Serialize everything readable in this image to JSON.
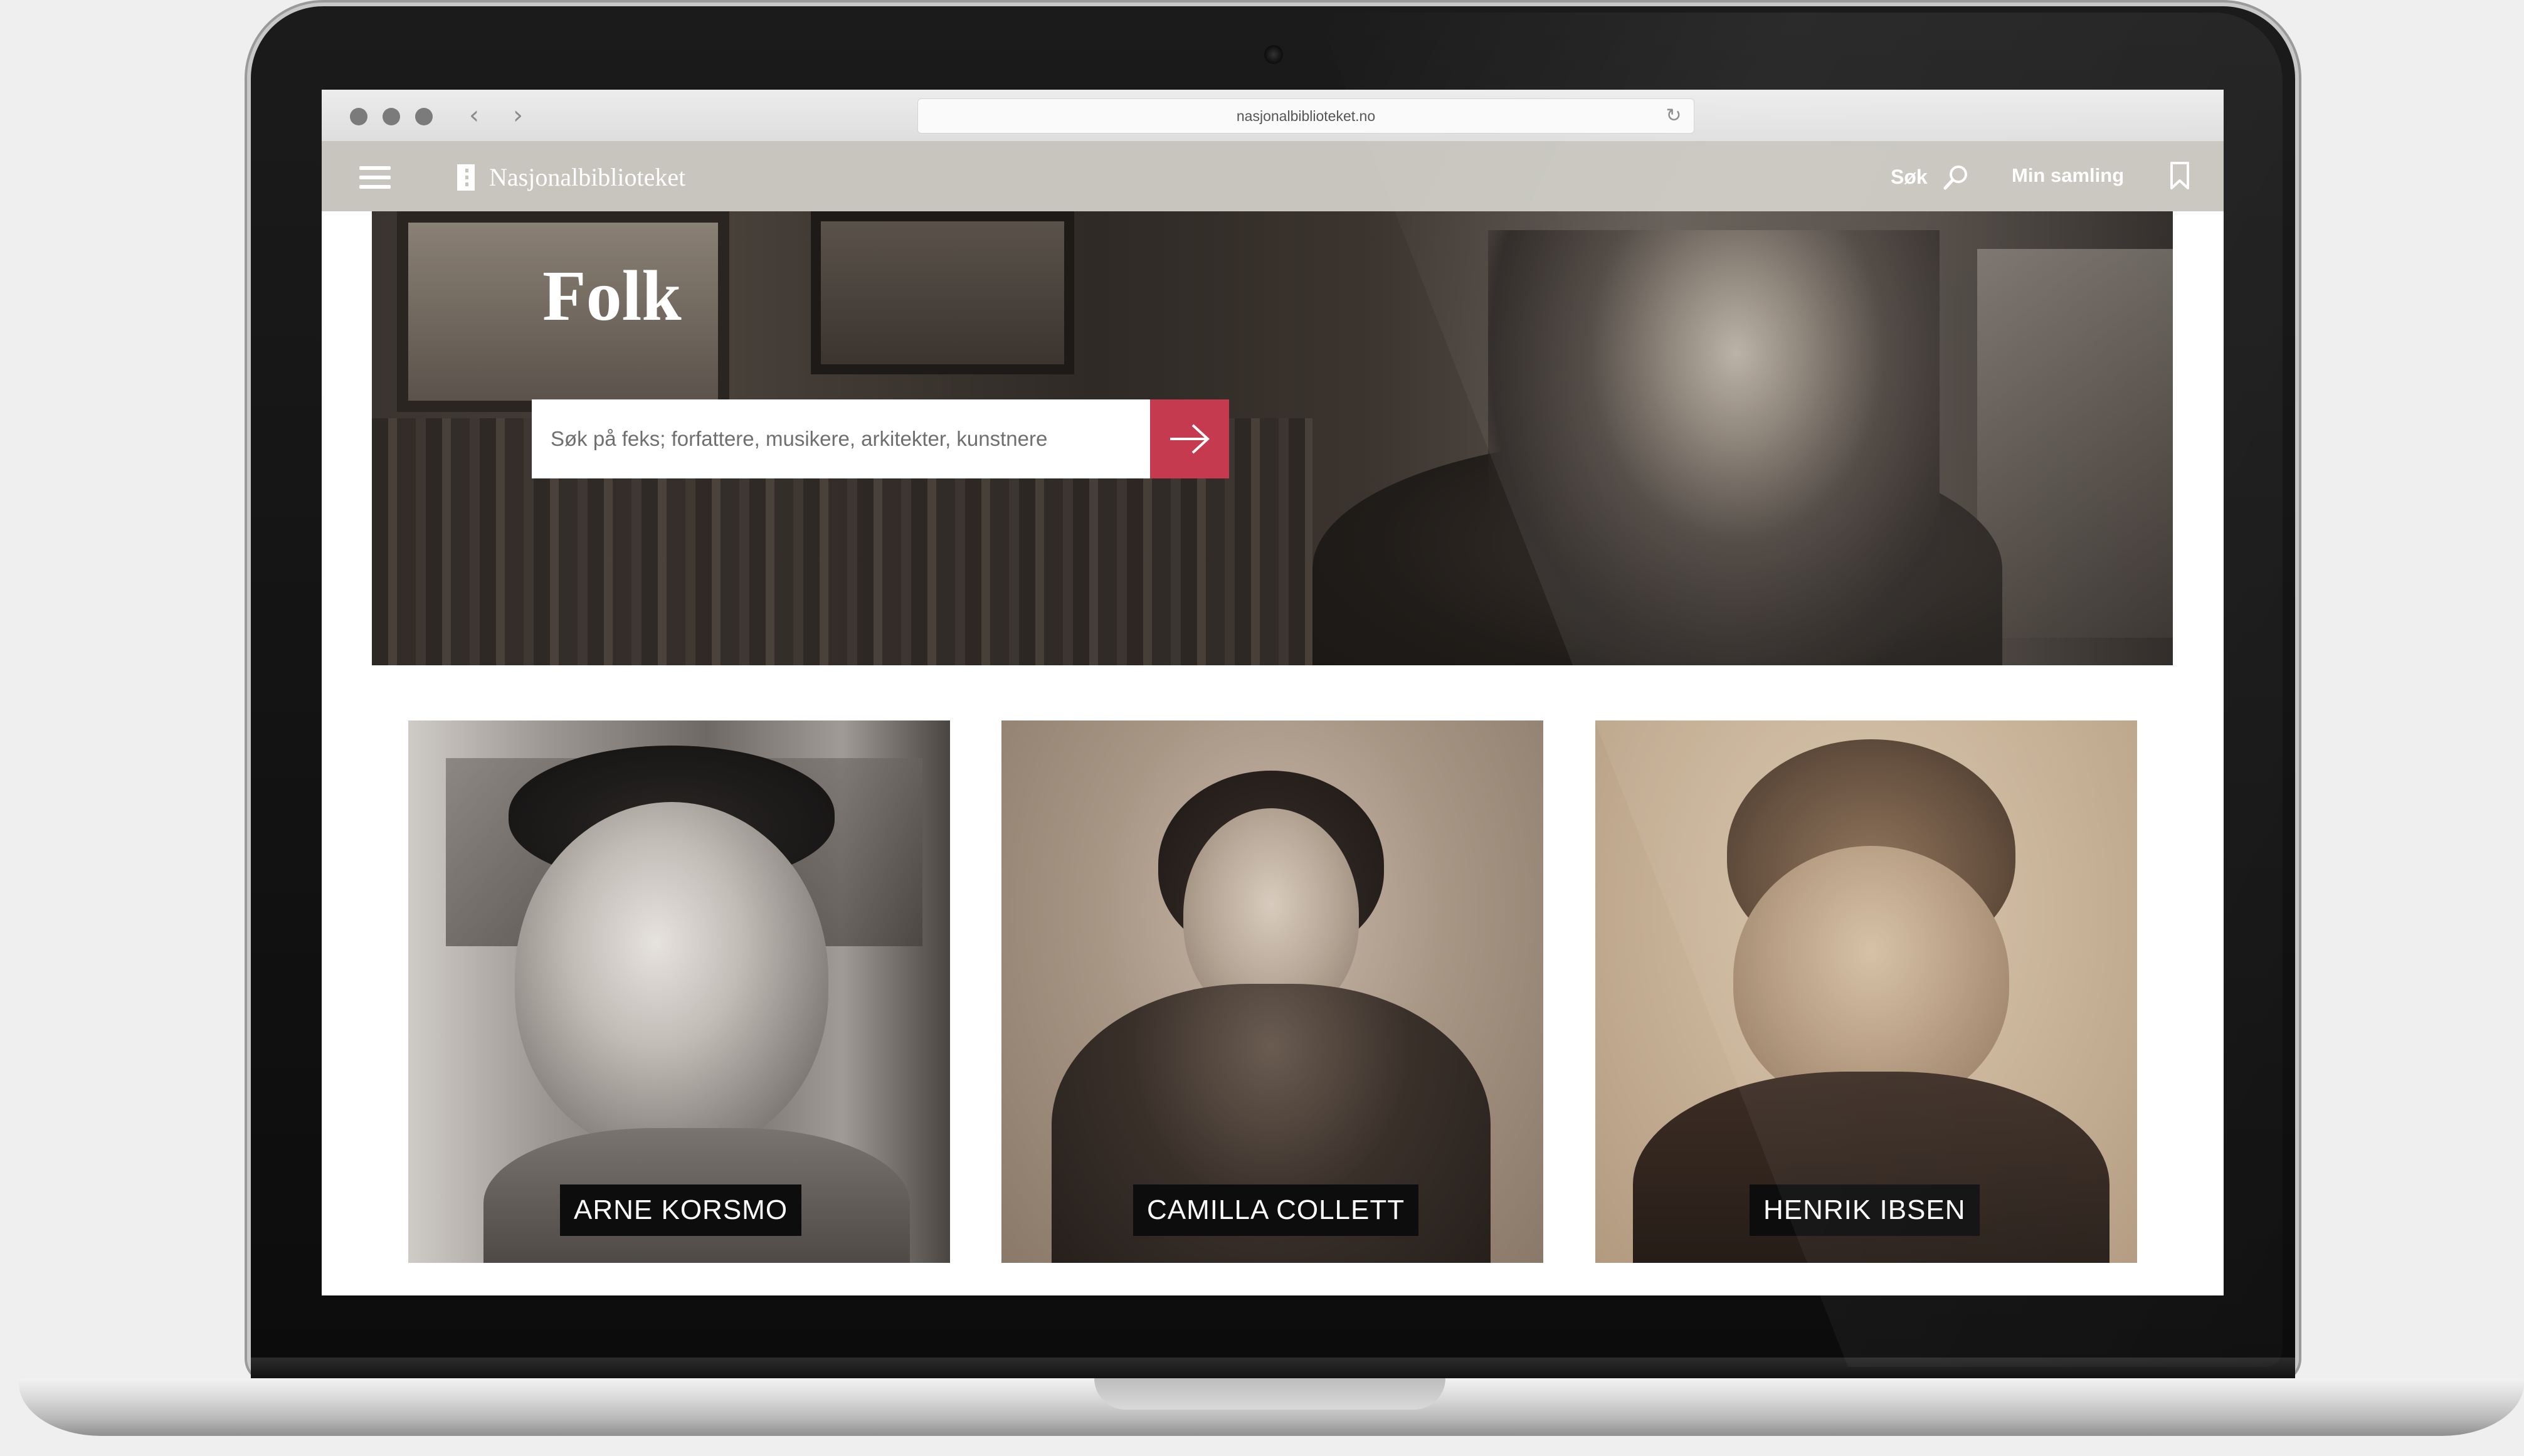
{
  "browser": {
    "url": "nasjonalbiblioteket.no"
  },
  "header": {
    "logo_text": "Nasjonalbiblioteket",
    "search_label": "Søk",
    "collection_label": "Min samling"
  },
  "hero": {
    "title": "Folk",
    "search_placeholder": "Søk på feks; forfattere, musikere, arkitekter, kunstnere"
  },
  "people": [
    {
      "name": "ARNE KORSMO"
    },
    {
      "name": "CAMILLA COLLETT"
    },
    {
      "name": "HENRIK IBSEN"
    }
  ],
  "colors": {
    "header_bg": "#c7c5bd",
    "accent": "#c63a4f",
    "name_tag_bg": "#0d0d0d"
  }
}
